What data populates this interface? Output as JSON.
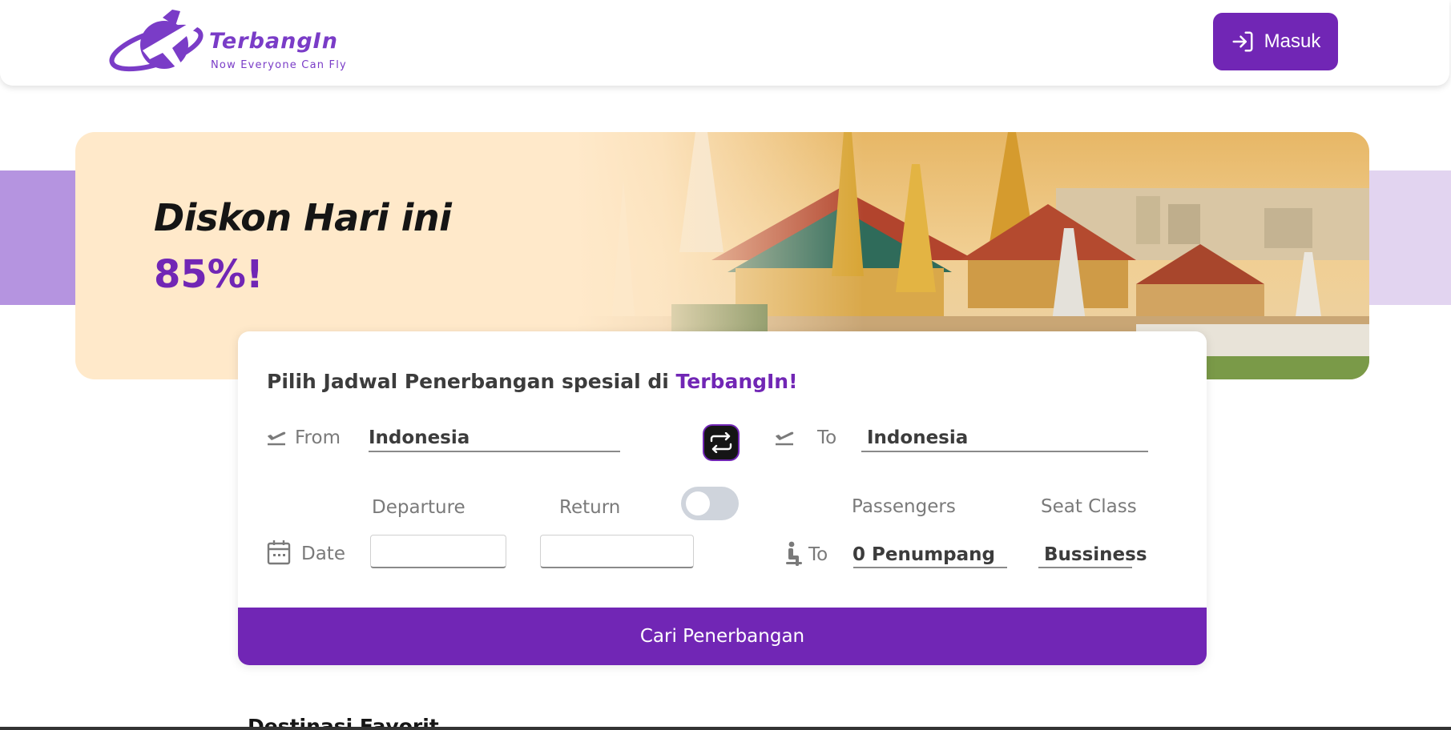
{
  "header": {
    "logo_text": "TerbangIn",
    "logo_tagline": "Now Everyone Can Fly",
    "login_label": "Masuk"
  },
  "hero": {
    "title": "Diskon Hari ini",
    "discount": "85%!"
  },
  "search": {
    "title_prefix": "Pilih Jadwal Penerbangan spesial di ",
    "title_brand": "TerbangIn!",
    "from_label": "From",
    "from_value": "Indonesia",
    "to_label": "To",
    "to_value": "Indonesia",
    "departure_label": "Departure",
    "return_label": "Return",
    "date_label": "Date",
    "departure_value": "",
    "return_value": "",
    "return_toggle_on": false,
    "passengers_label": "Passengers",
    "seat_class_label": "Seat Class",
    "passenger_row_label": "To",
    "passengers_value": "0 Penumpang",
    "seat_class_value": "Bussiness",
    "submit_label": "Cari Penerbangan"
  },
  "favorites": {
    "title": "Destinasi Favorit"
  },
  "colors": {
    "brand": "#7126b5",
    "hero_bg": "#ffe9ca"
  },
  "icons": [
    "login-icon",
    "plane-takeoff-icon",
    "swap-icon",
    "calendar-icon",
    "seat-icon"
  ]
}
